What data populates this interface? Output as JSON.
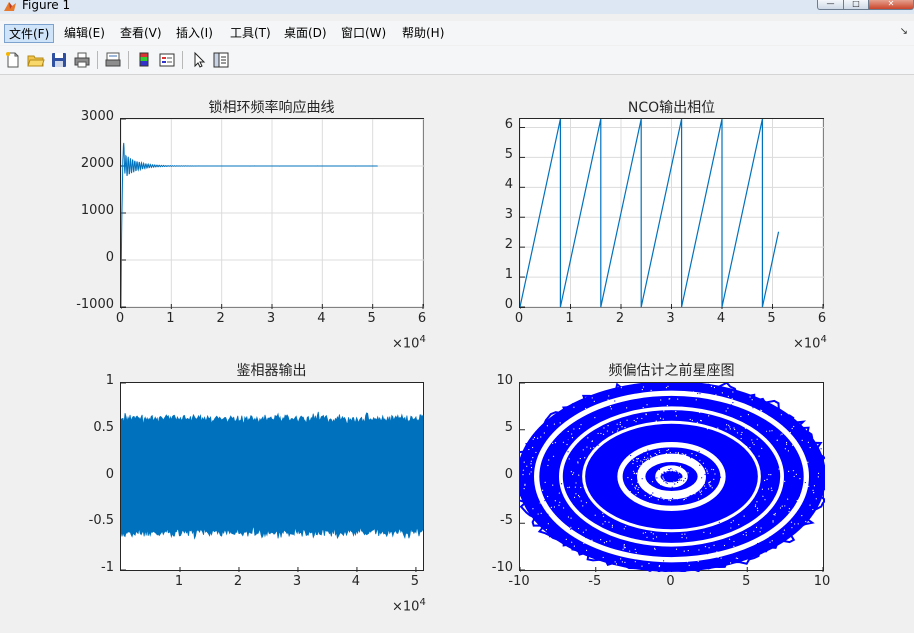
{
  "window": {
    "title": "Figure 1"
  },
  "menu": {
    "items": [
      {
        "label": "文件(F)",
        "x": 4
      },
      {
        "label": "编辑(E)",
        "x": 60
      },
      {
        "label": "查看(V)",
        "x": 116
      },
      {
        "label": "插入(I)",
        "x": 172
      },
      {
        "label": "工具(T)",
        "x": 226
      },
      {
        "label": "桌面(D)",
        "x": 280
      },
      {
        "label": "窗口(W)",
        "x": 337
      },
      {
        "label": "帮助(H)",
        "x": 398
      }
    ]
  },
  "toolbar": {
    "icons": [
      "new-figure-icon",
      "open-file-icon",
      "save-icon",
      "print-icon",
      "print-preview-icon",
      "colorbar-icon",
      "legend-icon",
      "pointer-icon",
      "property-editor-icon"
    ]
  },
  "chart_data": [
    {
      "type": "line",
      "title": "锁相环频率响应曲线",
      "xlim": [
        0,
        60000
      ],
      "ylim": [
        -1000,
        3000
      ],
      "x_ticks": [
        "0",
        "1",
        "2",
        "3",
        "4",
        "5",
        "6"
      ],
      "y_ticks": [
        "3000",
        "2000",
        "1000",
        "0",
        "-1000"
      ],
      "x_exponent": "10",
      "x_exponent_power": "4",
      "series_color": "#0072bd",
      "description_points": {
        "start": [
          0,
          -1000
        ],
        "overshoot": [
          500,
          2300
        ],
        "settle": 2000,
        "end_x": 51000
      },
      "grid": true
    },
    {
      "type": "line",
      "title": "NCO输出相位",
      "xlim": [
        0,
        60000
      ],
      "ylim": [
        0,
        6.2832
      ],
      "x_ticks": [
        "0",
        "1",
        "2",
        "3",
        "4",
        "5",
        "6"
      ],
      "y_ticks": [
        "6",
        "5",
        "4",
        "3",
        "2",
        "1",
        "0"
      ],
      "x_exponent": "10",
      "x_exponent_power": "4",
      "series_color": "#0072bd",
      "period": 8000,
      "end_x": 51200,
      "end_y": 2.55,
      "grid": true
    },
    {
      "type": "line",
      "title": "鉴相器输出",
      "xlim": [
        0,
        51200
      ],
      "ylim": [
        -1,
        1
      ],
      "x_ticks": [
        "1",
        "2",
        "3",
        "4",
        "5"
      ],
      "y_ticks": [
        "1",
        "0.5",
        "0",
        "-0.5",
        "-1"
      ],
      "x_exponent": "10",
      "x_exponent_power": "4",
      "series_color": "#0072bd",
      "envelope": [
        -0.6,
        0.62
      ],
      "grid": false
    },
    {
      "type": "scatter",
      "title": "频偏估计之前星座图",
      "xlim": [
        -10,
        10
      ],
      "ylim": [
        -10,
        10
      ],
      "x_ticks": [
        "-10",
        "-5",
        "0",
        "5",
        "10"
      ],
      "y_ticks": [
        "10",
        "5",
        "0",
        "-5",
        "-10"
      ],
      "series_color": "#0000ff",
      "rings": [
        1.2,
        2.6,
        8.5,
        9.6
      ],
      "grid": false
    }
  ]
}
